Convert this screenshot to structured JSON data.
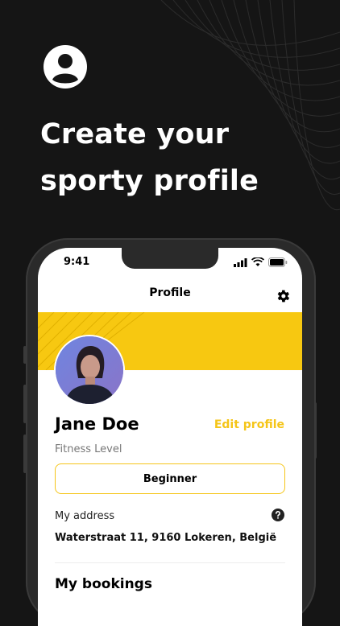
{
  "promo": {
    "headline": "Create your sporty profile"
  },
  "status_bar": {
    "time": "9:41"
  },
  "nav": {
    "title": "Profile"
  },
  "profile": {
    "name": "Jane Doe",
    "edit_label": "Edit profile",
    "fitness_label": "Fitness Level",
    "fitness_value": "Beginner",
    "address_label": "My address",
    "address_value": "Waterstraat 11, 9160 Lokeren, België",
    "bookings_title": "My bookings"
  },
  "colors": {
    "background": "#151515",
    "accent": "#f5c518",
    "banner": "#f7c811"
  },
  "icons": [
    "user-circle-icon",
    "signal-icon",
    "wifi-icon",
    "battery-icon",
    "gear-icon",
    "help-icon"
  ]
}
